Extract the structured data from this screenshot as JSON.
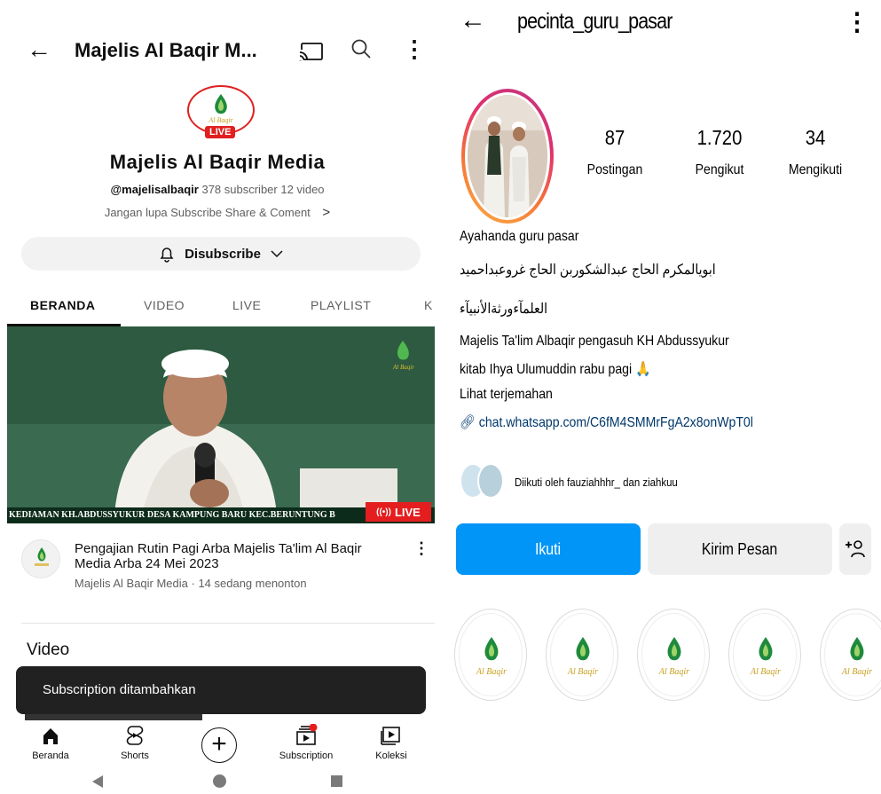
{
  "youtube": {
    "header": {
      "title": "Majelis Al Baqir M...",
      "back_icon": "arrow-left-icon",
      "cast_icon": "cast-icon",
      "search_icon": "search-icon",
      "more_icon": "more-vert-icon"
    },
    "channel": {
      "logo_text": "Al Baqir",
      "live_badge": "LIVE",
      "name": "Majelis Al Baqir Media",
      "handle": "@majelisalbaqir",
      "subscribers": "378 subscriber",
      "videos": "12 video",
      "description": "Jangan lupa Subscribe Share & Coment"
    },
    "subscribe_button": {
      "label": "Disubscribe",
      "bell_icon": "bell-icon",
      "chevron_icon": "chevron-down-icon"
    },
    "tabs": [
      "BERANDA",
      "VIDEO",
      "LIVE",
      "PLAYLIST",
      "K"
    ],
    "active_tab": "BERANDA",
    "featured_video": {
      "ticker": "KEDIAMAN KH.ABDUSSYUKUR DESA KAMPUNG BARU KEC.BERUNTUNG B",
      "live_label": "LIVE",
      "title": "Pengajian Rutin Pagi Arba Majelis Ta'lim Al Baqir Media Arba  24 Mei  2023",
      "meta": "Majelis Al Baqir Media · 14 sedang menonton"
    },
    "section_title": "Video",
    "toast": "Subscription ditambahkan",
    "bottom_nav": [
      {
        "label": "Beranda",
        "icon": "home-icon"
      },
      {
        "label": "Shorts",
        "icon": "shorts-icon"
      },
      {
        "label": "",
        "icon": "create-plus-icon"
      },
      {
        "label": "Subscription",
        "icon": "subscriptions-icon"
      },
      {
        "label": "Koleksi",
        "icon": "library-icon"
      }
    ]
  },
  "instagram": {
    "header": {
      "username": "pecinta_guru_pasar",
      "back_icon": "arrow-left-icon",
      "more_icon": "more-vert-icon"
    },
    "stats": [
      {
        "value": "87",
        "label": "Postingan"
      },
      {
        "value": "1.720",
        "label": "Pengikut"
      },
      {
        "value": "34",
        "label": "Mengikuti"
      }
    ],
    "bio": {
      "name": "Ayahanda guru pasar",
      "arabic_1": "ابويالمكرم الحاج عبدالشكوربن الحاج غروعبداحميد",
      "arabic_2": "العلمآءورثةالأنبيآء",
      "line_3": "Majelis Ta'lim Albaqir pengasuh KH Abdussyukur",
      "line_4": "kitab Ihya Ulumuddin rabu pagi 🙏",
      "translate": "Lihat terjemahan",
      "link": "chat.whatsapp.com/C6fM4SMMrFgA2x8onWpT0l"
    },
    "followed_by": "Diikuti oleh fauziahhhr_ dan ziahkuu",
    "buttons": {
      "follow": "Ikuti",
      "message": "Kirim Pesan",
      "add_user_icon": "add-user-icon"
    },
    "highlight_logo_text": "Al Baqir",
    "colors": {
      "follow_blue": "#0095f6",
      "youtube_red": "#e41e1e",
      "logo_green": "#1e8a3c"
    }
  }
}
